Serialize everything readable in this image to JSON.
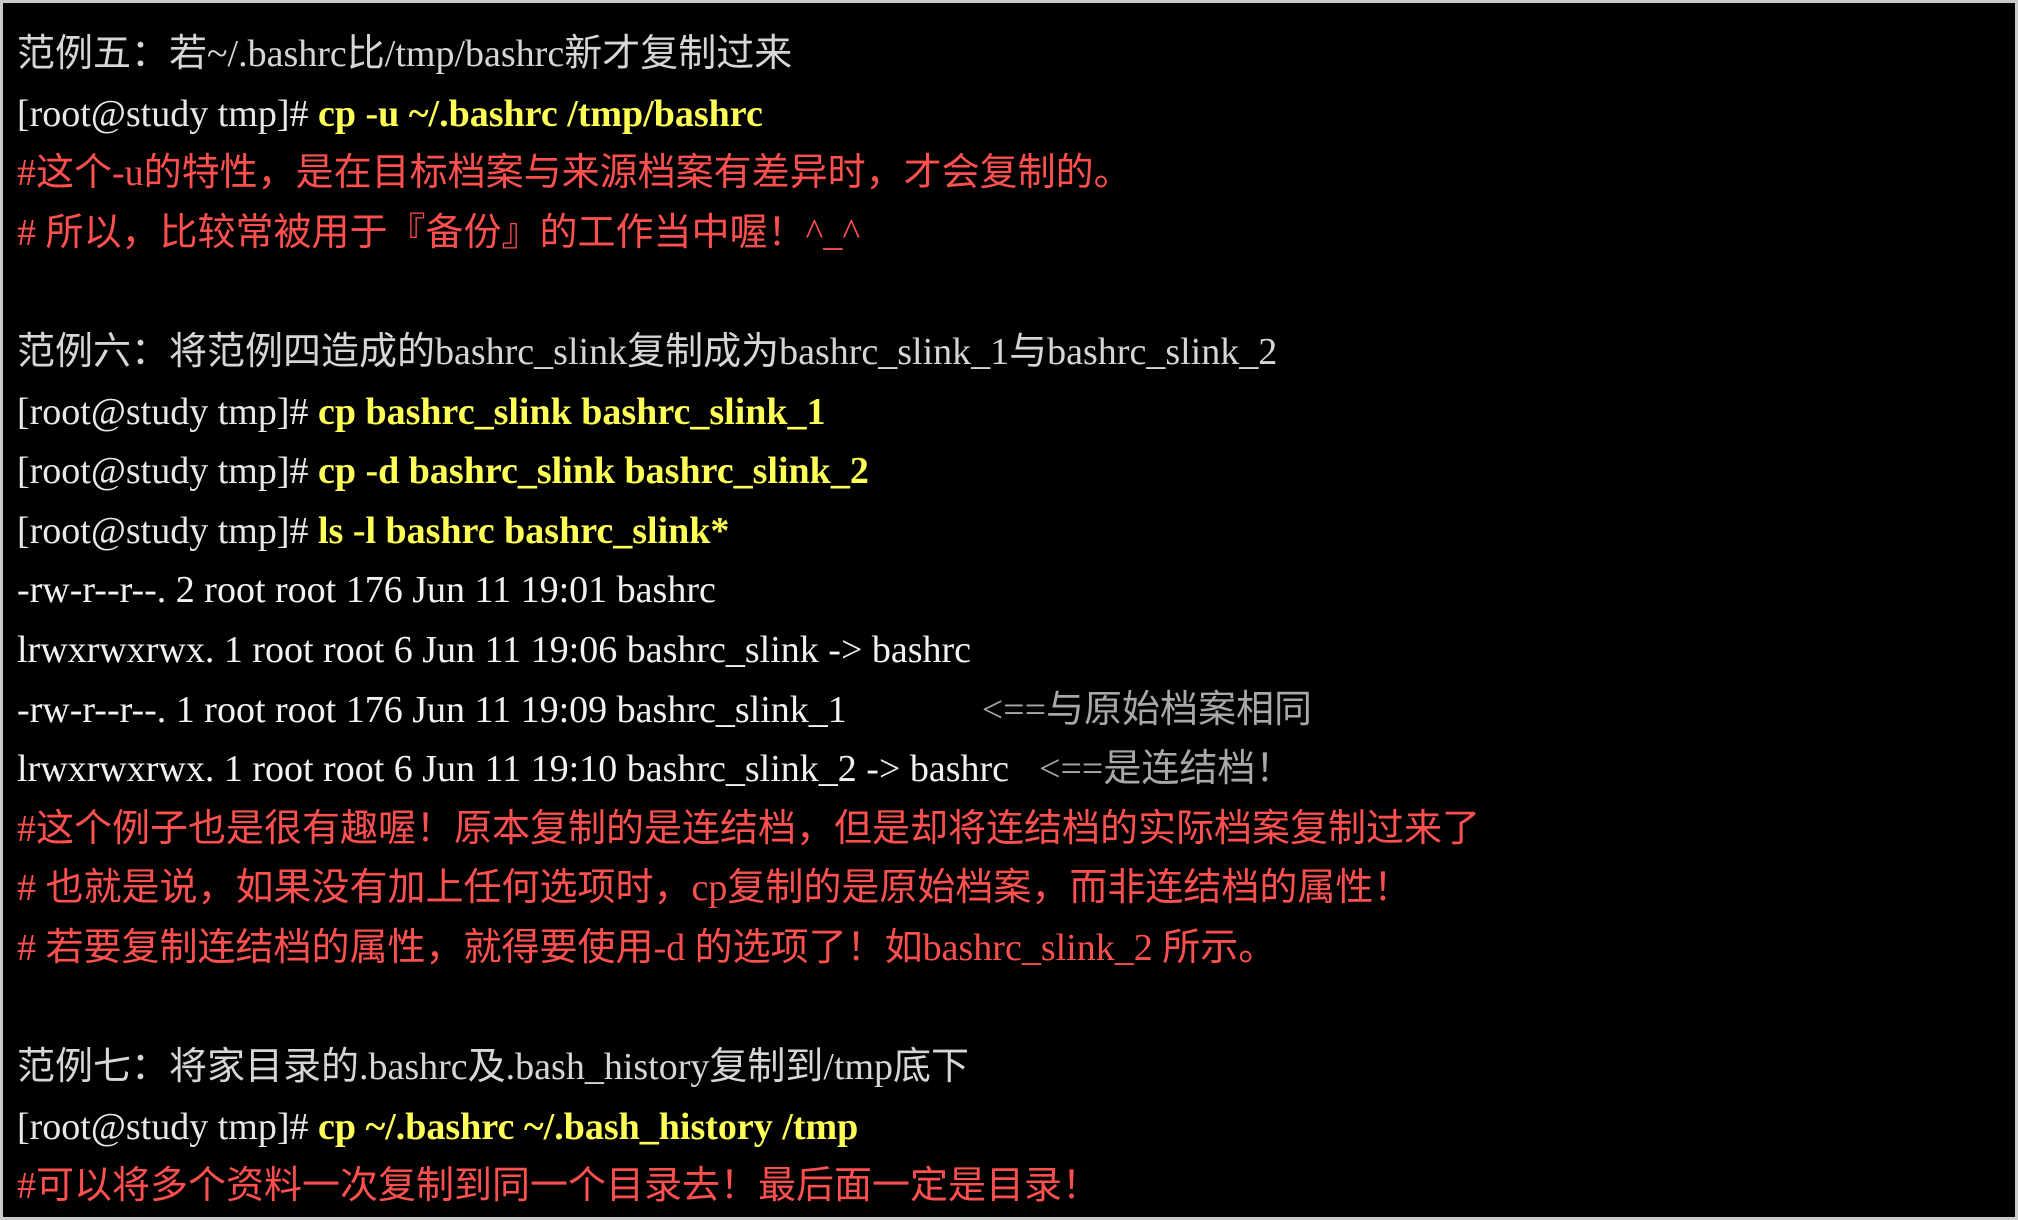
{
  "colors": {
    "background": "#000000",
    "prompt": "#e8e8e8",
    "command": "#ffff55",
    "comment": "#ff5050",
    "heading": "#d6d6d6",
    "note": "#a8a8a8"
  },
  "terminal": {
    "prompt": "[root@study tmp]# ",
    "example5": {
      "heading": "范例五：若~/.bashrc比/tmp/bashrc新才复制过来",
      "cmd1": "cp -u ~/.bashrc /tmp/bashrc",
      "comment1": "#这个-u的特性，是在目标档案与来源档案有差异时，才会复制的。",
      "comment2": "# 所以，比较常被用于『备份』的工作当中喔！^_^"
    },
    "example6": {
      "heading": "范例六：将范例四造成的bashrc_slink复制成为bashrc_slink_1与bashrc_slink_2",
      "cmd1": "cp bashrc_slink bashrc_slink_1",
      "cmd2": "cp -d bashrc_slink bashrc_slink_2",
      "cmd3": "ls -l bashrc bashrc_slink*",
      "out1": "-rw-r--r--. 2 root root 176 Jun 11 19:01 bashrc",
      "out2": "lrwxrwxrwx. 1 root root 6 Jun 11 19:06 bashrc_slink -> bashrc",
      "out3": "-rw-r--r--. 1 root root 176 Jun 11 19:09 bashrc_slink_1",
      "out3_note": "<==与原始档案相同",
      "out4": "lrwxrwxrwx. 1 root root 6 Jun 11 19:10 bashrc_slink_2 -> bashrc",
      "out4_note": "<==是连结档！",
      "comment1": "#这个例子也是很有趣喔！原本复制的是连结档，但是却将连结档的实际档案复制过来了",
      "comment2": "# 也就是说，如果没有加上任何选项时，cp复制的是原始档案，而非连结档的属性！",
      "comment3": "# 若要复制连结档的属性，就得要使用-d 的选项了！如bashrc_slink_2 所示。"
    },
    "example7": {
      "heading": "范例七：将家目录的.bashrc及.bash_history复制到/tmp底下",
      "cmd1": "cp ~/.bashrc ~/.bash_history /tmp",
      "comment1": "#可以将多个资料一次复制到同一个目录去！最后面一定是目录！"
    }
  }
}
